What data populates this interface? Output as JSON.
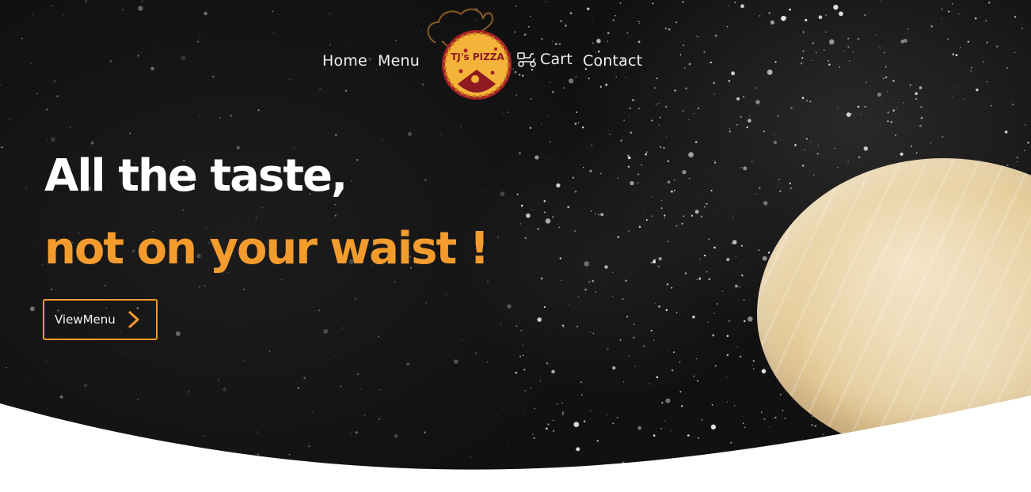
{
  "nav": {
    "home_label": "Home",
    "menu_label": "Menu",
    "cart_label": "Cart",
    "contact_label": "Contact",
    "cart_icon": "scooter-icon"
  },
  "logo": {
    "text": "TJ's PIZZA",
    "icon": "chef-hat-pizza-logo"
  },
  "hero": {
    "headline_line1": "All the taste,",
    "headline_line2": "not on your waist !",
    "cta_label": "ViewMenu",
    "cta_icon": "chevron-right-icon"
  },
  "colors": {
    "accent": "#f39c2d",
    "hero_background": "#111010",
    "text_light": "#ffffff"
  }
}
